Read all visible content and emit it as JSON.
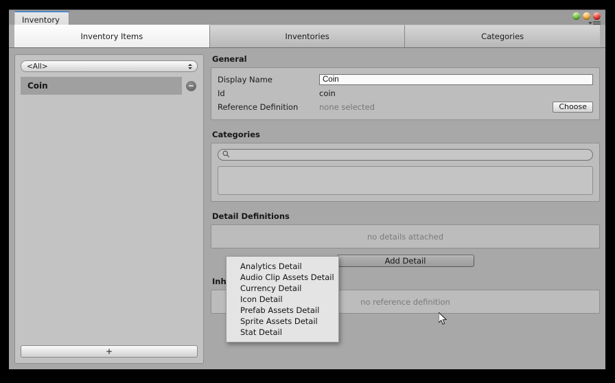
{
  "window": {
    "tab_title": "Inventory",
    "controls": [
      {
        "name": "maximize-button",
        "color": "#6fc13d"
      },
      {
        "name": "minimize-button",
        "color": "#f3ab3c"
      },
      {
        "name": "close-button",
        "color": "#e8382c"
      }
    ],
    "menu_icon": "hamburger-menu-icon"
  },
  "tabs": [
    {
      "label": "Inventory Items",
      "selected": true
    },
    {
      "label": "Inventories",
      "selected": false
    },
    {
      "label": "Categories",
      "selected": false
    }
  ],
  "sidebar": {
    "filter_value": "<All>",
    "items": [
      {
        "label": "Coin",
        "selected": true
      }
    ],
    "add_label": "+"
  },
  "general": {
    "title": "General",
    "display_name_label": "Display Name",
    "display_name_value": "Coin",
    "display_name_placeholder": "Display Name",
    "id_label": "Id",
    "id_value": "coin",
    "reference_label": "Reference Definition",
    "reference_value": "none selected",
    "choose_label": "Choose"
  },
  "categories": {
    "title": "Categories",
    "search_value": "",
    "search_placeholder": "",
    "list_items": []
  },
  "detail_definitions": {
    "title": "Detail Definitions",
    "empty_text": "no details attached",
    "add_button_label": "Add Detail"
  },
  "inherited_detail_definitions": {
    "title": "Inherited Detail Definitions",
    "empty_text": "no reference definition"
  },
  "detail_menu": {
    "items": [
      "Analytics Detail",
      "Audio Clip Assets Detail",
      "Currency Detail",
      "Icon Detail",
      "Prefab Assets Detail",
      "Sprite Assets Detail",
      "Stat Detail"
    ]
  }
}
